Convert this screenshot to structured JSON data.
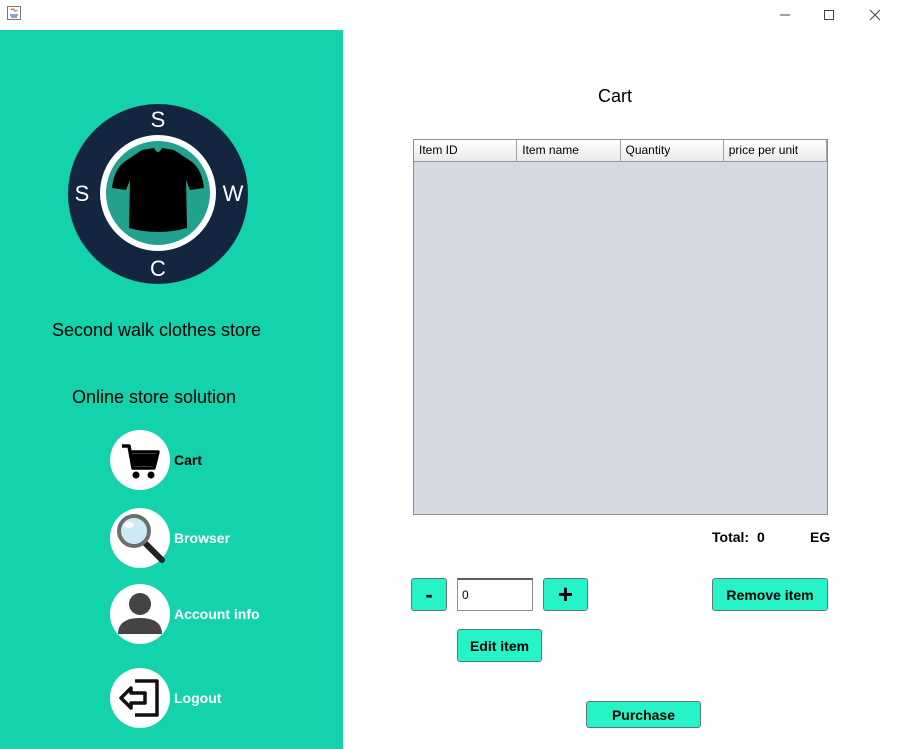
{
  "window": {
    "minimize_glyph": "—",
    "maximize_glyph": "☐",
    "close_glyph": "✕"
  },
  "sidebar": {
    "logo_letters": {
      "top": "S",
      "left": "S",
      "right": "W",
      "bottom": "C"
    },
    "store_name": "Second walk clothes store",
    "subtitle": "Online store solution",
    "nav": [
      {
        "label": "Cart",
        "icon": "cart-icon",
        "active": true
      },
      {
        "label": "Browser",
        "icon": "magnifier-icon",
        "active": false
      },
      {
        "label": "Account info",
        "icon": "user-icon",
        "active": false
      },
      {
        "label": "Logout",
        "icon": "logout-icon",
        "active": false
      }
    ]
  },
  "main": {
    "title": "Cart",
    "table": {
      "columns": [
        "Item ID",
        "Item name",
        "Quantity",
        "price per unit"
      ],
      "rows": []
    },
    "total": {
      "label": "Total:",
      "value": "0",
      "currency": "EG"
    },
    "quantity": {
      "value": "0"
    },
    "buttons": {
      "minus": "-",
      "plus": "+",
      "remove": "Remove item",
      "edit": "Edit item",
      "purchase": "Purchase"
    }
  },
  "colors": {
    "sidebar_bg": "#13d2ac",
    "button_bg": "#27f3c9",
    "logo_ring": "#13253f",
    "logo_center": "#22a18d"
  }
}
